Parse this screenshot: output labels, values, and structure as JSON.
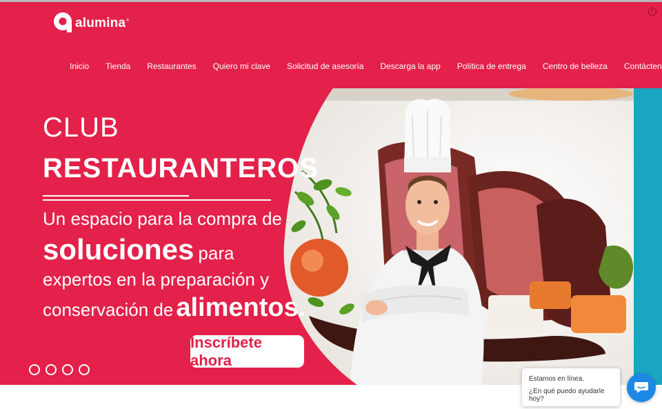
{
  "brand": {
    "name": "alumina",
    "registered": "®",
    "logo_icon": "alumina-a-logo-icon",
    "color": "#e3214a"
  },
  "header": {
    "power_icon": "power-icon"
  },
  "nav": {
    "items": [
      {
        "label": "Inicio"
      },
      {
        "label": "Tienda"
      },
      {
        "label": "Restaurantes"
      },
      {
        "label": "Quiero mi clave"
      },
      {
        "label": "Solicitud de asesoría"
      },
      {
        "label": "Descarga la app"
      },
      {
        "label": "Política de entrega"
      },
      {
        "label": "Centro de belleza"
      },
      {
        "label": "Contáctenos"
      }
    ]
  },
  "hero": {
    "title_light": "CLUB",
    "title_bold": "RESTAURANTEROS",
    "line1": "Un espacio para la compra de",
    "line2_bold": "soluciones",
    "line2_light": "para",
    "line3": "expertos en la preparación y",
    "line4_light": "conservación de",
    "line4_bold": "alimentos.",
    "cta": "Inscríbete ahora",
    "image": "chef-with-steak-dish-photo",
    "accent_color": "#1aa6c2",
    "slides": 4
  },
  "chat": {
    "line1": "Estamos en línea.",
    "line2": "¿En qué puedo ayudarle hoy?",
    "icon": "chat-icon",
    "color": "#1e88e5"
  }
}
